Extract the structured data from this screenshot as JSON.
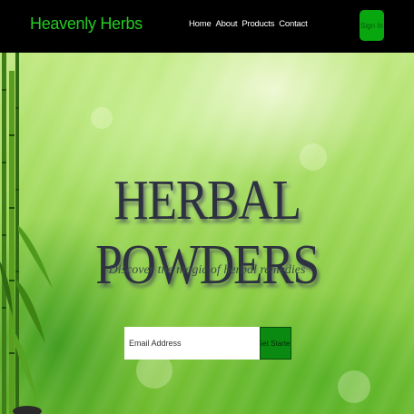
{
  "header": {
    "brand": "Heavenly Herbs",
    "nav": [
      "Home",
      "About",
      "Products",
      "Contact"
    ],
    "signin_label": "Sign In"
  },
  "hero": {
    "title": "HERBAL POWDERS",
    "tagline": "Discover the magic of herbal remedies",
    "email_placeholder": "Email Address",
    "cta_label": "Get Started"
  },
  "colors": {
    "header_bg": "#000000",
    "brand": "#22cc22",
    "button": "#09a70f",
    "title": "#2d3140"
  }
}
